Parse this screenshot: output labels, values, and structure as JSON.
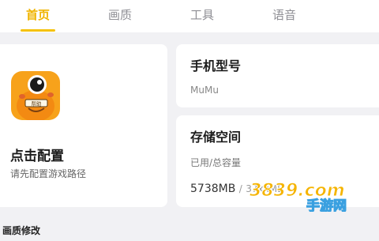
{
  "tabs": [
    {
      "label": "首页",
      "active": true
    },
    {
      "label": "画质",
      "active": false
    },
    {
      "label": "工具",
      "active": false
    },
    {
      "label": "语音",
      "active": false
    }
  ],
  "colors": {
    "accent": "#f5c20a",
    "tab_active": "#f0b400",
    "tab_inactive": "#8f8f95",
    "background": "#f1f1f4",
    "card": "#ffffff"
  },
  "config_card": {
    "icon": "app-mascot-icon",
    "icon_label": "帮助",
    "title": "点击配置",
    "subtitle": "请先配置游戏路径"
  },
  "model_card": {
    "title": "手机型号",
    "value": "MuMu"
  },
  "storage_card": {
    "title": "存储空间",
    "label": "已用/总容量",
    "used": "5738MB",
    "separator": "/",
    "total": "37xxMB"
  },
  "section": {
    "label": "画质修改"
  },
  "watermark": {
    "logo_text": "3839.com",
    "sub_text": "手游网"
  }
}
